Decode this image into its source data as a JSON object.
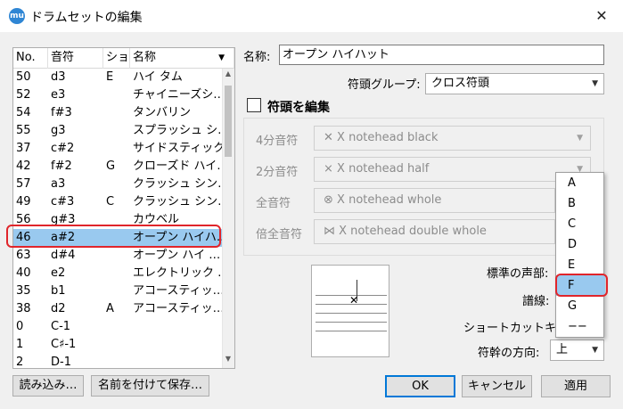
{
  "window": {
    "title": "ドラムセットの編集",
    "app_icon": "mu-logo-icon",
    "close": "✕"
  },
  "table": {
    "headers": [
      "No.",
      "音符",
      "ショー",
      "名称"
    ],
    "rows": [
      [
        "50",
        "d3",
        "E",
        "ハイ タム"
      ],
      [
        "52",
        "e3",
        "",
        "チャイニーズシ…"
      ],
      [
        "54",
        "f#3",
        "",
        "タンバリン"
      ],
      [
        "55",
        "g3",
        "",
        "スプラッシュ シ…"
      ],
      [
        "37",
        "c#2",
        "",
        "サイドスティック"
      ],
      [
        "42",
        "f#2",
        "G",
        "クローズド ハイ…"
      ],
      [
        "57",
        "a3",
        "",
        "クラッシュ シン…"
      ],
      [
        "49",
        "c#3",
        "C",
        "クラッシュ シン…"
      ],
      [
        "56",
        "g#3",
        "",
        "カウベル"
      ],
      [
        "46",
        "a#2",
        "",
        "オープン ハイハ…"
      ],
      [
        "63",
        "d#4",
        "",
        "オープン ハイ …"
      ],
      [
        "40",
        "e2",
        "",
        "エレクトリック …"
      ],
      [
        "35",
        "b1",
        "",
        "アコースティッ…"
      ],
      [
        "38",
        "d2",
        "A",
        "アコースティッ…"
      ],
      [
        "0",
        "C-1",
        "",
        ""
      ],
      [
        "1",
        "C♯-1",
        "",
        ""
      ],
      [
        "2",
        "D-1",
        "",
        ""
      ]
    ],
    "selected_index": 9
  },
  "buttons": {
    "load": "読み込み…",
    "save_as": "名前を付けて保存…",
    "ok": "OK",
    "cancel": "キャンセル",
    "apply": "適用"
  },
  "form": {
    "name_label": "名称:",
    "name_value": "オープン ハイハット",
    "group_label": "符頭グループ:",
    "group_value": "クロス符頭",
    "edit_label": "符頭を編集",
    "quarter_label": "4分音符",
    "quarter_value": "X notehead black",
    "half_label": "2分音符",
    "half_value": "X notehead half",
    "whole_label": "全音符",
    "whole_value": "X notehead whole",
    "double_label": "倍全音符",
    "double_value": "X notehead double whole",
    "voice_label": "標準の声部:",
    "line_label": "譜線:",
    "shortcut_label": "ショートカットキー:",
    "stem_label": "符幹の方向:",
    "stem_value": "上"
  },
  "shortcut_options": [
    "A",
    "B",
    "C",
    "D",
    "E",
    "F",
    "G",
    "−−"
  ],
  "shortcut_selected": 5,
  "colors": {
    "selection": "#99c9ef",
    "highlight": "#e0252b",
    "focus": "#0078d7"
  }
}
